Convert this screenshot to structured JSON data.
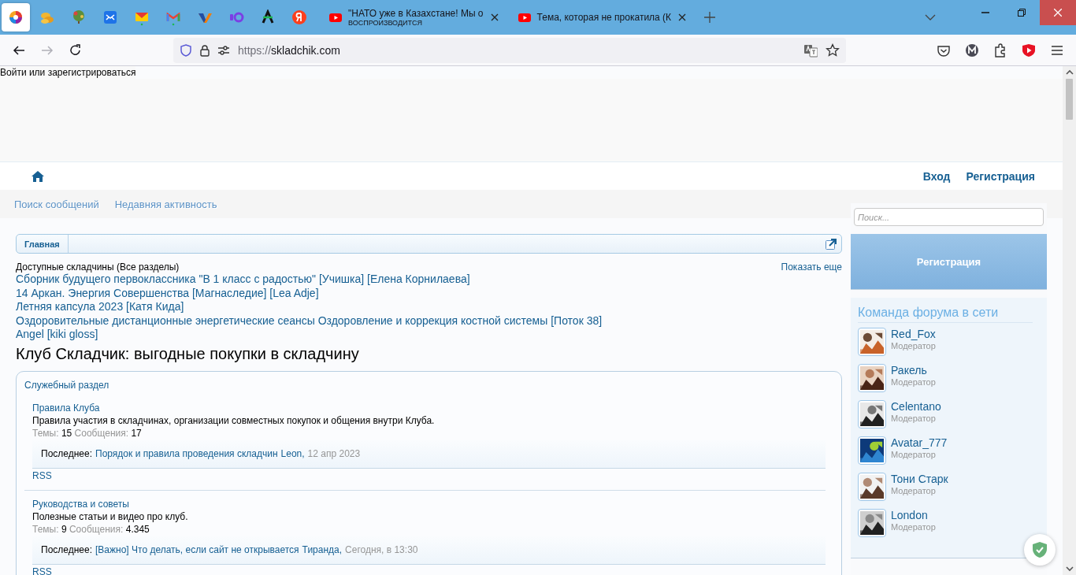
{
  "browser": {
    "pinned_tabs": [
      {
        "selected": true
      },
      {
        "selected": false
      },
      {
        "selected": false
      },
      {
        "selected": false
      },
      {
        "selected": false
      },
      {
        "selected": false
      },
      {
        "selected": false
      },
      {
        "selected": false
      },
      {
        "selected": false
      },
      {
        "selected": false
      }
    ],
    "tabs": [
      {
        "title": "\"НАТО уже в Казахстане! Мы о",
        "subtitle": "ВОСПРОИЗВОДИТСЯ",
        "selected": false
      },
      {
        "title": "Тема, которая не прокатила (К",
        "selected": false
      }
    ],
    "forward_disabled": true,
    "url_scheme": "https://",
    "url_host": "skladchik.com"
  },
  "login_bar": "Войти или зарегистрироваться",
  "header": {
    "links": [
      "Вход",
      "Регистрация"
    ]
  },
  "nav": [
    "Поиск сообщений",
    "Недавняя активность"
  ],
  "breadcrumb": [
    "Главная"
  ],
  "available": {
    "title": "Доступные складчины (Все разделы)",
    "more": "Показать еще",
    "items": [
      "Сборник будущего первоклассника \"В 1 класс с радостью\" [Учишка] [Елена Корнилаева]",
      "14 Аркан. Энергия Совершенства [Магнаследие] [Lea Adje]",
      "Летняя капсула 2023 [Катя Кида]",
      "Оздоровительные дистанционные энергетические сеансы Оздоровление и коррекция костной системы [Поток 38]",
      "Angel [kiki gloss]"
    ]
  },
  "heading": "Клуб Складчик: выгодные покупки в складчину",
  "category": {
    "title": "Служебный раздел",
    "forums": [
      {
        "title": "Правила Клуба",
        "description": "Правила участия в складчинах, организации совместных покупок и общения внутри Клуба.",
        "stats": [
          {
            "label": "Темы:",
            "value": "15"
          },
          {
            "label": "Сообщения:",
            "value": "17"
          }
        ],
        "last_label": "Последнее:",
        "last_thread": "Порядок и правила проведения складчин",
        "last_user": "Leon,",
        "last_date": "12 апр 2023",
        "rss": "RSS"
      },
      {
        "title": "Руководства и советы",
        "description": "Полезные статьи и видео про клуб.",
        "stats": [
          {
            "label": "Темы:",
            "value": "9"
          },
          {
            "label": "Сообщения:",
            "value": "4.345"
          }
        ],
        "last_label": "Последнее:",
        "last_thread": "[Важно] Что делать, если сайт не открывается",
        "last_user": "Тиранда,",
        "last_date": "Сегодня, в 13:30",
        "rss": "RSS"
      }
    ]
  },
  "sidebar": {
    "search_placeholder": "Поиск...",
    "register": "Регистрация",
    "staff": {
      "title": "Команда форума в сети",
      "members": [
        {
          "name": "Red_Fox",
          "role": "Модератор"
        },
        {
          "name": "Ракель",
          "role": "Модератор"
        },
        {
          "name": "Celentano",
          "role": "Модератор"
        },
        {
          "name": "Avatar_777",
          "role": "Модератор"
        },
        {
          "name": "Тони Старк",
          "role": "Модератор"
        },
        {
          "name": "London",
          "role": "Модератор"
        }
      ]
    }
  }
}
